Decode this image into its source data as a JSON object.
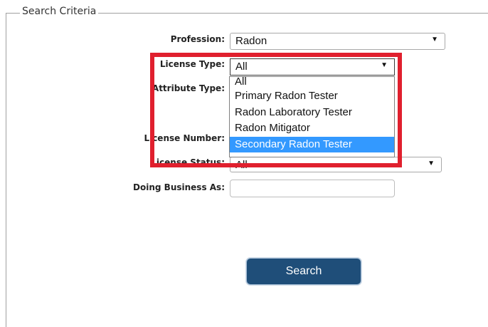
{
  "fieldset": {
    "legend": "Search Criteria"
  },
  "fields": {
    "profession": {
      "label": "Profession:",
      "value": "Radon"
    },
    "license_type": {
      "label": "License Type:",
      "value": "All"
    },
    "attribute_type": {
      "label": "Attribute Type:"
    },
    "license_number": {
      "label": "License Number:"
    },
    "license_status": {
      "label": "License Status:",
      "value": "All"
    },
    "doing_business_as": {
      "label": "Doing Business As:",
      "value": ""
    }
  },
  "license_type_options": [
    "All",
    "Primary Radon Tester",
    "Radon Laboratory Tester",
    "Radon Mitigator",
    "Secondary Radon Tester"
  ],
  "highlighted_option_index": 4,
  "search_button": {
    "label": "Search"
  },
  "colors": {
    "highlight_box": "#e0202e",
    "selected_option": "#3399ff",
    "button": "#1f4e79"
  }
}
